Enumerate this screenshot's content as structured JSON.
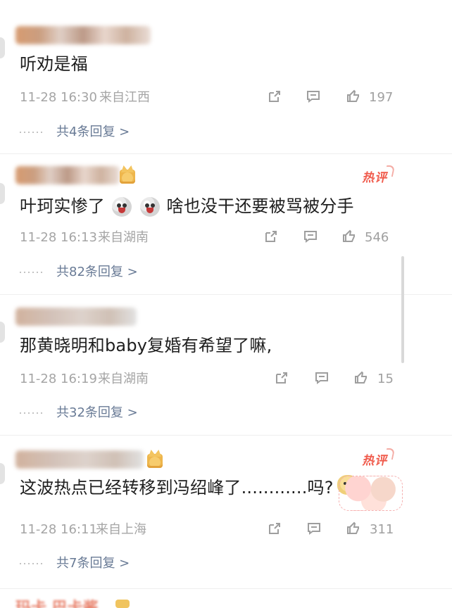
{
  "comments": [
    {
      "text": "听劝是福",
      "time": "11-28 16:30",
      "source": "来自江西",
      "likes": "197",
      "replies": "共4条回复 >",
      "hot": false
    },
    {
      "text_part1": "叶珂实惨了",
      "text_part2": "啥也没干还要被骂被分手",
      "time": "11-28 16:13",
      "source": "来自湖南",
      "likes": "546",
      "replies": "共82条回复 >",
      "hot": true,
      "hot_label": "热评"
    },
    {
      "text": "那黄晓明和baby复婚有希望了嘛,",
      "time": "11-28 16:19",
      "source": "来自湖南",
      "likes": "15",
      "replies": "共32条回复 >",
      "hot": false
    },
    {
      "text": "这波热点已经转移到冯绍峰了............吗?",
      "time": "11-28 16:11",
      "source": "来自上海",
      "likes": "311",
      "replies": "共7条回复 >",
      "hot": true,
      "hot_label": "热评"
    }
  ],
  "bottom_partial_text": "玛卡 巴卡酱",
  "colors": {
    "hot_badge": "#f05b4c",
    "reply_link": "#687a95",
    "meta_text": "#a5a5a5"
  },
  "icons": {
    "share": "share-icon",
    "comment": "comment-icon",
    "like": "like-icon"
  }
}
